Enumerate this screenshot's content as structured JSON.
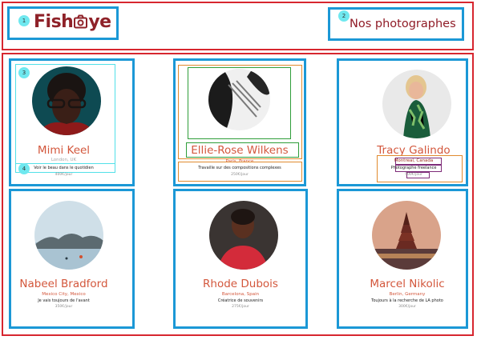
{
  "header": {
    "logo_before": "Fish",
    "logo_after": "ye",
    "nav_label": "Nos photographes",
    "badge1": "1",
    "badge2": "2"
  },
  "cards": [
    {
      "name": "Mimi Keel",
      "location": "London, UK",
      "tagline": "Voir le beau dans le quotidien",
      "price": "400€/jour",
      "badge_top": "3",
      "badge_bottom": "4"
    },
    {
      "name": "Ellie-Rose Wilkens",
      "location": "Paris, France",
      "tagline": "Travaille sur des compositions complexes",
      "price": "250€/jour"
    },
    {
      "name": "Tracy Galindo",
      "location": "Montreal, Canada",
      "tagline": "Photographe freelance",
      "price": "500€/jour"
    },
    {
      "name": "Nabeel Bradford",
      "location": "Mexico City, Mexico",
      "tagline": "Je vais toujours de l'avant",
      "price": "350€/jour"
    },
    {
      "name": "Rhode Dubois",
      "location": "Barcelona, Spain",
      "tagline": "Créatrice de souvenirs",
      "price": "275€/jour"
    },
    {
      "name": "Marcel Nikolic",
      "location": "Berlin, Germany",
      "tagline": "Toujours à la recherche de LA photo",
      "price": "300€/jour"
    }
  ]
}
